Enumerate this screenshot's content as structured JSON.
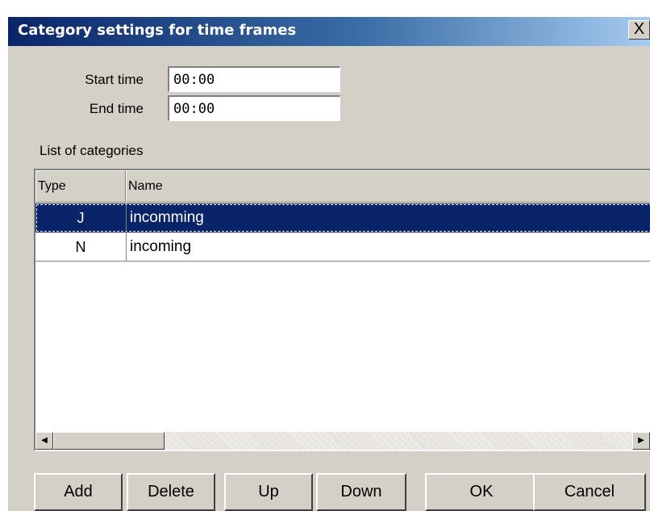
{
  "dialog": {
    "title": "Category settings for time frames",
    "close_label": "X"
  },
  "fields": {
    "start_label": "Start time",
    "start_value": "00:00",
    "end_label": "End time",
    "end_value": "00:00"
  },
  "list": {
    "label": "List of categories",
    "columns": [
      "Type",
      "Name"
    ],
    "rows": [
      {
        "type": "J",
        "name": "incomming",
        "selected": true
      },
      {
        "type": "N",
        "name": "incoming",
        "selected": false
      }
    ]
  },
  "scrollbar": {
    "left_icon": "arrow-left-icon",
    "right_icon": "arrow-right-icon"
  },
  "buttons": {
    "add": "Add",
    "delete": "Delete",
    "up": "Up",
    "down": "Down",
    "ok": "OK",
    "cancel": "Cancel"
  },
  "colors": {
    "titlebar_start": "#0a246a",
    "titlebar_end": "#a6caf0",
    "selection": "#0a246a",
    "face": "#d4d0c8"
  }
}
